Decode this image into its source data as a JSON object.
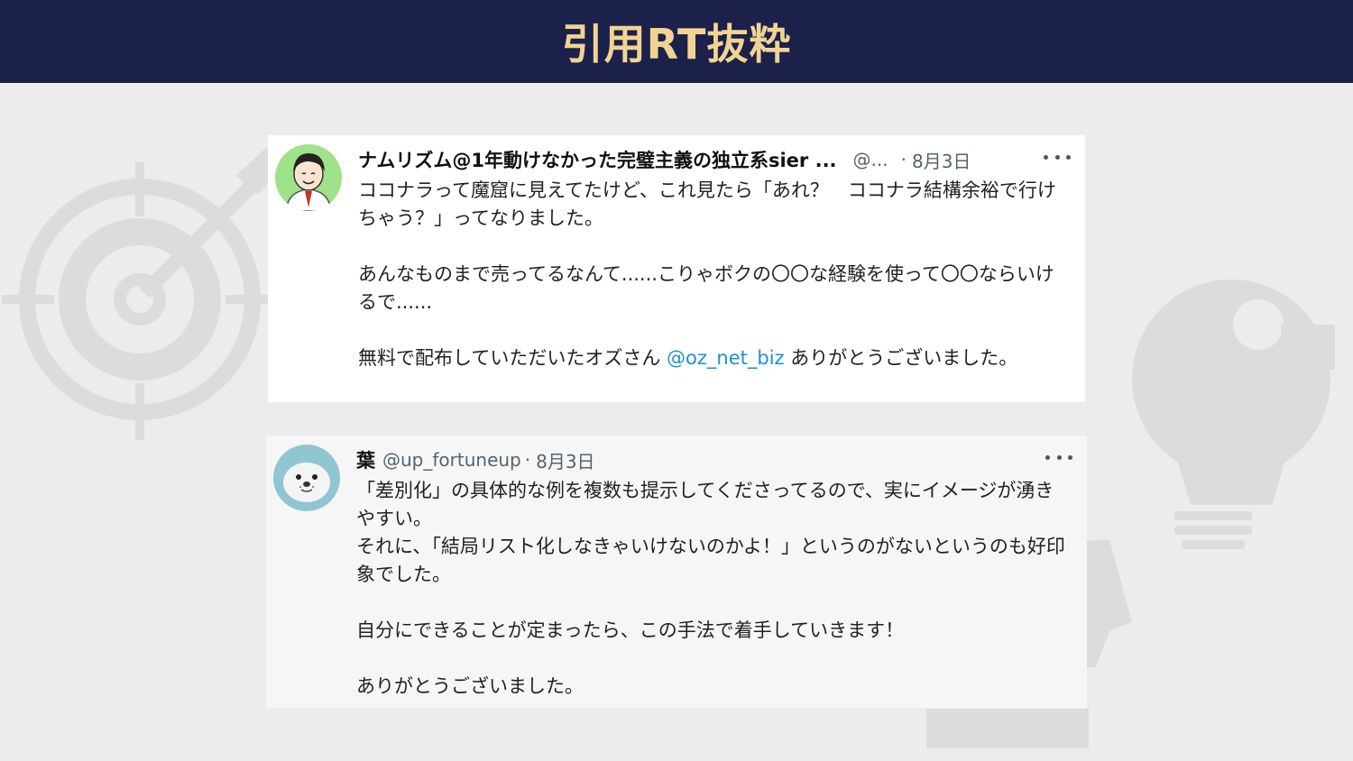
{
  "slide": {
    "title": "引用RT抜粋"
  },
  "tweets": [
    {
      "name": "ナムリズム@1年動けなかった完璧主義の独立系sier ...",
      "handle": "@...",
      "dot": "·",
      "date": "8月3日",
      "lines": {
        "p1": "ココナラって魔窟に見えてたけど、これ見たら「あれ？　ココナラ結構余裕で行けちゃう？」ってなりました。",
        "p2": "あんなものまで売ってるなんて......こりゃボクの〇〇な経験を使って〇〇ならいけるで......",
        "p3_before": "無料で配布していただいたオズさん ",
        "p3_mention": "@oz_net_biz",
        "p3_after": " ありがとうございました。"
      }
    },
    {
      "name": "葉",
      "handle": "@up_fortuneup",
      "dot": "·",
      "date": "8月3日",
      "lines": {
        "p1": "「差別化」の具体的な例を複数も提示してくださってるので、実にイメージが湧きやすい。",
        "p2": "それに、「結局リスト化しなきゃいけないのかよ！」というのがないというのも好印象でした。",
        "p3": "自分にできることが定まったら、この手法で着手していきます！",
        "p4": "ありがとうございました。"
      }
    }
  ],
  "colors": {
    "header_bg": "#1b214b",
    "title": "#f2d492",
    "mention": "#1d8fd9",
    "background": "#ececec"
  }
}
